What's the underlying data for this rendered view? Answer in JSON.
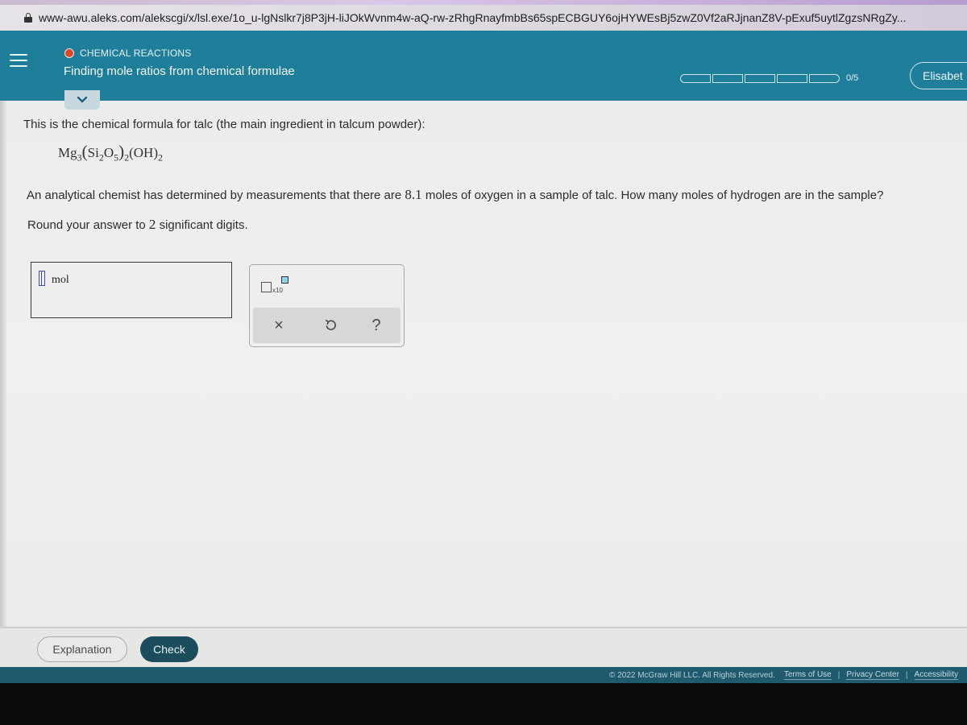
{
  "browser": {
    "url": "www-awu.aleks.com/alekscgi/x/lsl.exe/1o_u-lgNslkr7j8P3jH-liJOkWvnm4w-aQ-rw-zRhgRnayfmbBs65spECBGUY6ojHYWEsBj5zwZ0Vf2aRJjnanZ8V-pExuf5uytlZgzsNRgZy...",
    "lock_icon": "lock-icon"
  },
  "header": {
    "menu_icon": "hamburger-icon",
    "topic_label": "CHEMICAL REACTIONS",
    "topic_status_color": "#d94a2b",
    "title": "Finding mole ratios from chemical formulae",
    "progress": {
      "completed": 0,
      "total": 5,
      "label": "0/5"
    },
    "user_name": "Elisabet",
    "collapse_icon": "chevron-down-icon",
    "accent_color": "#1f7f9a"
  },
  "question": {
    "intro": "This is the chemical formula for talc (the main ingredient in talcum powder):",
    "formula": {
      "mg": "Mg",
      "mg_sub": "3",
      "si": "Si",
      "si_sub": "2",
      "o": "O",
      "o_sub": "5",
      "group1_sub": "2",
      "oh": "OH",
      "oh_sub": "2"
    },
    "text_before": "An analytical chemist has determined by measurements that there are ",
    "oxygen_moles": "8.1",
    "text_after": " moles of oxygen in a sample of talc. How many moles of hydrogen are in the sample?",
    "round_before": "Round your answer to ",
    "sig_digits": "2",
    "round_after": " significant digits."
  },
  "answer": {
    "value": "",
    "unit": "mol"
  },
  "tools": {
    "sci_label": "x10",
    "clear_icon": "×",
    "undo_icon": "↺",
    "help_icon": "?"
  },
  "actions": {
    "explanation": "Explanation",
    "check": "Check",
    "check_color": "#1c4d5c"
  },
  "footer": {
    "copyright": "© 2022 McGraw Hill LLC. All Rights Reserved.",
    "links": [
      "Terms of Use",
      "Privacy Center",
      "Accessibility"
    ],
    "separator": "|"
  }
}
